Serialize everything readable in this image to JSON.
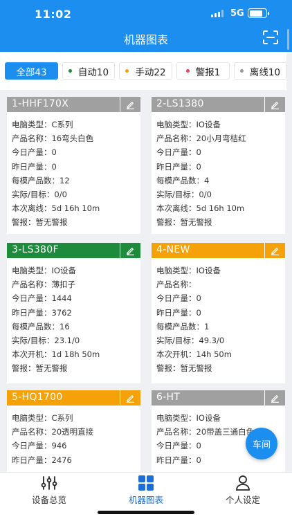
{
  "status_bar": {
    "time": "11:02",
    "network": "5G"
  },
  "header": {
    "title": "机器图表"
  },
  "filters": [
    {
      "label": "全部43",
      "active": true,
      "dot_color": ""
    },
    {
      "label": "自动10",
      "active": false,
      "dot_color": "#1e8a3c"
    },
    {
      "label": "手动22",
      "active": false,
      "dot_color": "#f5a20a"
    },
    {
      "label": "警报1",
      "active": false,
      "dot_color": "#e8445a"
    },
    {
      "label": "离线10",
      "active": false,
      "dot_color": "#999999"
    }
  ],
  "colors": {
    "primary": "#1b8ef0",
    "offline": "#a0a0a0",
    "auto": "#1e8a3c",
    "manual": "#f5a20a"
  },
  "machines": [
    {
      "name": "1-HHF170X",
      "status_color": "#a0a0a0",
      "rows": [
        {
          "k": "电脑类型：",
          "v": "C系列"
        },
        {
          "k": "产品名称：",
          "v": "16弯头白色"
        },
        {
          "k": "今日产量：",
          "v": "0"
        },
        {
          "k": "昨日产量：",
          "v": "0"
        },
        {
          "k": "每模产品数：",
          "v": "12"
        },
        {
          "k": "实际/目标：",
          "v": "0/0"
        },
        {
          "k": "本次离线：",
          "v": "5d 16h 10m"
        },
        {
          "k": "警报：",
          "v": "暂无警报"
        }
      ]
    },
    {
      "name": "2-LS1380",
      "status_color": "#a0a0a0",
      "rows": [
        {
          "k": "电脑类型：",
          "v": "IO设备"
        },
        {
          "k": "产品名称：",
          "v": "20小月弯桔红"
        },
        {
          "k": "今日产量：",
          "v": "0"
        },
        {
          "k": "昨日产量：",
          "v": "0"
        },
        {
          "k": "每模产品数：",
          "v": "4"
        },
        {
          "k": "实际/目标：",
          "v": "0/0"
        },
        {
          "k": "本次离线：",
          "v": "5d 16h 10m"
        },
        {
          "k": "警报：",
          "v": "暂无警报"
        }
      ]
    },
    {
      "name": "3-LS380F",
      "status_color": "#1e8a3c",
      "rows": [
        {
          "k": "电脑类型：",
          "v": "IO设备"
        },
        {
          "k": "产品名称：",
          "v": "薄扣子"
        },
        {
          "k": "今日产量：",
          "v": "1444"
        },
        {
          "k": "昨日产量：",
          "v": "3762"
        },
        {
          "k": "每模产品数：",
          "v": "16"
        },
        {
          "k": "实际/目标：",
          "v": "23.1/0"
        },
        {
          "k": "本次开机：",
          "v": "1d 18h 50m"
        },
        {
          "k": "警报：",
          "v": "暂无警报"
        }
      ]
    },
    {
      "name": "4-NEW",
      "status_color": "#f5a20a",
      "rows": [
        {
          "k": "电脑类型：",
          "v": "IO设备"
        },
        {
          "k": "产品名称：",
          "v": ""
        },
        {
          "k": "今日产量：",
          "v": "0"
        },
        {
          "k": "昨日产量：",
          "v": "0"
        },
        {
          "k": "每模产品数：",
          "v": "1"
        },
        {
          "k": "实际/目标：",
          "v": "49.3/0"
        },
        {
          "k": "本次开机：",
          "v": "14h 50m"
        },
        {
          "k": "警报：",
          "v": "暂无警报"
        }
      ]
    },
    {
      "name": "5-HQ1700",
      "status_color": "#f5a20a",
      "rows": [
        {
          "k": "电脑类型：",
          "v": "C系列"
        },
        {
          "k": "产品名称：",
          "v": "20透明直接"
        },
        {
          "k": "今日产量：",
          "v": "946"
        },
        {
          "k": "昨日产量：",
          "v": "2476"
        }
      ]
    },
    {
      "name": "6-HT",
      "status_color": "#a0a0a0",
      "rows": [
        {
          "k": "电脑类型：",
          "v": "IO设备"
        },
        {
          "k": "产品名称：",
          "v": "20带盖三通白色"
        },
        {
          "k": "今日产量：",
          "v": "0"
        },
        {
          "k": "昨日产量：",
          "v": "0"
        }
      ]
    }
  ],
  "fab": {
    "label": "车间"
  },
  "tabs": [
    {
      "label": "设备总览",
      "icon": "sliders-icon",
      "active": false
    },
    {
      "label": "机器图表",
      "icon": "grid-icon",
      "active": true
    },
    {
      "label": "个人设定",
      "icon": "user-icon",
      "active": false
    }
  ]
}
